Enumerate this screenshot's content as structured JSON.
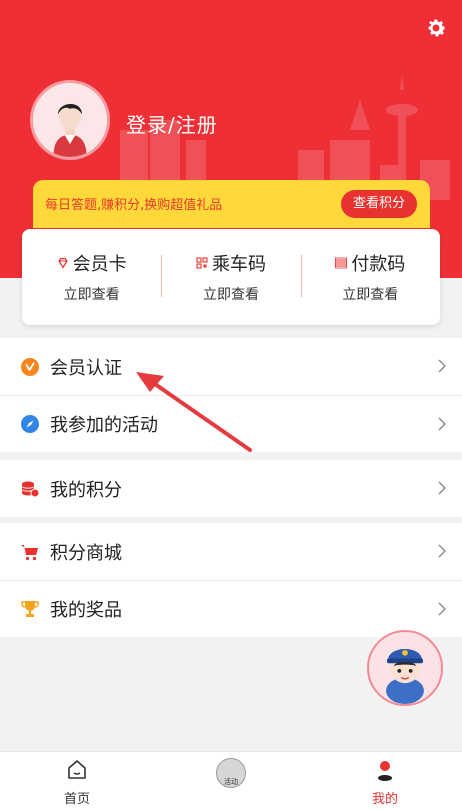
{
  "header": {
    "login_label": "登录/注册"
  },
  "banner": {
    "text": "每日答题,赚积分,换购超值礼品",
    "button_label": "查看积分"
  },
  "quick_cards": [
    {
      "title": "会员卡",
      "sub": "立即查看",
      "icon": "diamond-icon"
    },
    {
      "title": "乘车码",
      "sub": "立即查看",
      "icon": "qr-code-icon"
    },
    {
      "title": "付款码",
      "sub": "立即查看",
      "icon": "barcode-icon"
    }
  ],
  "menu": {
    "group1": [
      {
        "label": "会员认证",
        "icon": "verified-badge-icon"
      },
      {
        "label": "我参加的活动",
        "icon": "compass-icon"
      }
    ],
    "group2": [
      {
        "label": "我的积分",
        "icon": "points-stack-icon"
      }
    ],
    "group3": [
      {
        "label": "积分商城",
        "icon": "cart-icon"
      },
      {
        "label": "我的奖品",
        "icon": "trophy-icon"
      }
    ]
  },
  "tabbar": {
    "tabs": [
      {
        "label": "首页",
        "icon": "home-icon",
        "active": false
      },
      {
        "label": "",
        "badge": "活动",
        "icon": "activity-icon",
        "active": false
      },
      {
        "label": "我的",
        "icon": "user-icon",
        "active": true
      }
    ]
  },
  "colors": {
    "brand_red": "#ee2f35",
    "banner_yellow": "#ffd83a",
    "active_tab": "#e8322f"
  }
}
